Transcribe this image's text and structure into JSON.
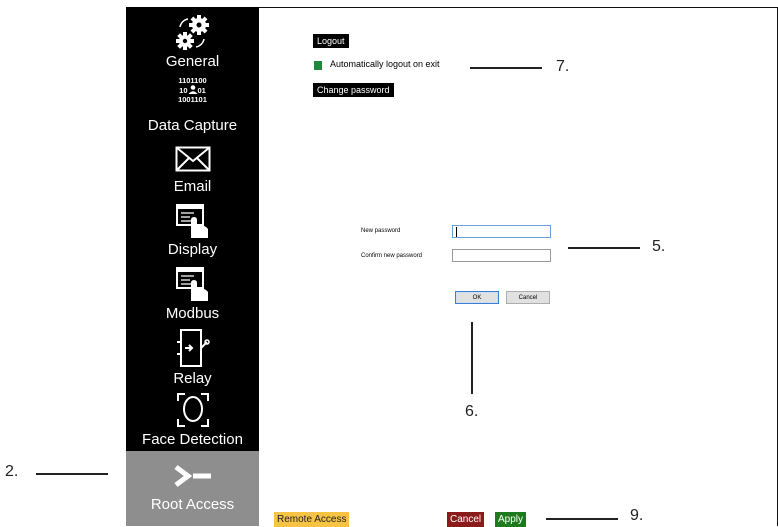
{
  "sidebar": {
    "items": [
      {
        "label": "General",
        "icon": "gears-icon"
      },
      {
        "label": "Data Capture",
        "icon": "binary-user-icon",
        "icon_text": [
          "1101100",
          "10",
          "01",
          "1001101"
        ]
      },
      {
        "label": "Email",
        "icon": "envelope-icon"
      },
      {
        "label": "Display",
        "icon": "display-touch-icon"
      },
      {
        "label": "Modbus",
        "icon": "modbus-touch-icon"
      },
      {
        "label": "Relay",
        "icon": "relay-switch-icon"
      },
      {
        "label": "Face Detection",
        "icon": "face-detection-icon"
      },
      {
        "label": "Root Access",
        "icon": "terminal-prompt-icon",
        "active": true
      }
    ]
  },
  "main": {
    "logout_label": "Logout",
    "auto_logout_label": "Automatically logout on exit",
    "auto_logout_checked": true,
    "change_password_label": "Change password"
  },
  "dialog": {
    "new_password_label": "New password",
    "confirm_password_label": "Confirm new password",
    "new_password_value": "",
    "confirm_password_value": "",
    "ok_label": "OK",
    "cancel_label": "Cancel"
  },
  "footer": {
    "remote_access_label": "Remote Access",
    "cancel_label": "Cancel",
    "apply_label": "Apply"
  },
  "callouts": {
    "sidebar": "2.",
    "password_fields": "5.",
    "dialog_buttons": "6.",
    "auto_logout": "7.",
    "footer_buttons": "9."
  },
  "colors": {
    "sidebar_bg": "#000000",
    "active_item_bg": "#8e8e8e",
    "checkbox_green": "#1d8a3a",
    "remote_access_bg": "#f6c343",
    "cancel_bg": "#8b1a1a",
    "apply_bg": "#1f7a1f"
  }
}
